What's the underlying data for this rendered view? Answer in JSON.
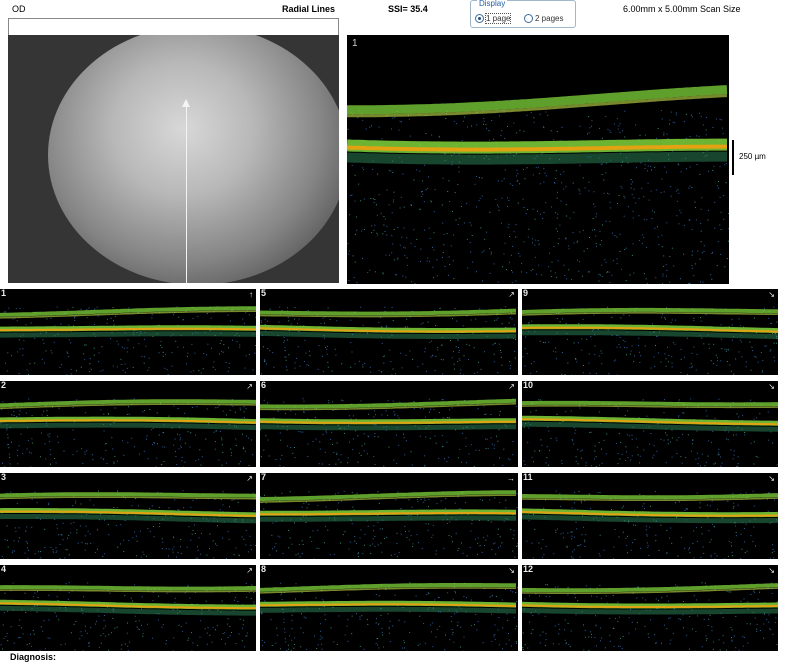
{
  "header": {
    "eye": "OD",
    "protocol": "Radial Lines",
    "ssi": "SSI= 35.4",
    "display": {
      "legend": "Display",
      "options": [
        {
          "label": "1 page",
          "selected": true
        },
        {
          "label": "2 pages",
          "selected": false
        }
      ]
    },
    "scan_size": "6.00mm x 5.00mm Scan Size"
  },
  "main_scan": {
    "number": "1",
    "scale_label": "250 µm"
  },
  "tiles": [
    {
      "number": "1",
      "direction_icon": "arrow-up"
    },
    {
      "number": "2",
      "direction_icon": "arrow-up-right"
    },
    {
      "number": "3",
      "direction_icon": "arrow-up-right"
    },
    {
      "number": "4",
      "direction_icon": "arrow-up-right"
    },
    {
      "number": "5",
      "direction_icon": "arrow-up-right"
    },
    {
      "number": "6",
      "direction_icon": "arrow-up-right"
    },
    {
      "number": "7",
      "direction_icon": "arrow-right"
    },
    {
      "number": "8",
      "direction_icon": "arrow-down-right"
    },
    {
      "number": "9",
      "direction_icon": "arrow-down-right"
    },
    {
      "number": "10",
      "direction_icon": "arrow-down-right"
    },
    {
      "number": "11",
      "direction_icon": "arrow-down-right"
    },
    {
      "number": "12",
      "direction_icon": "arrow-down-right"
    }
  ],
  "footer": {
    "diagnosis": "Diagnosis:"
  },
  "colors": {
    "retina_band": "#7fd43a",
    "rpe_band": "#f0a010",
    "noise": "#2f5fa0",
    "background": "#000000"
  }
}
